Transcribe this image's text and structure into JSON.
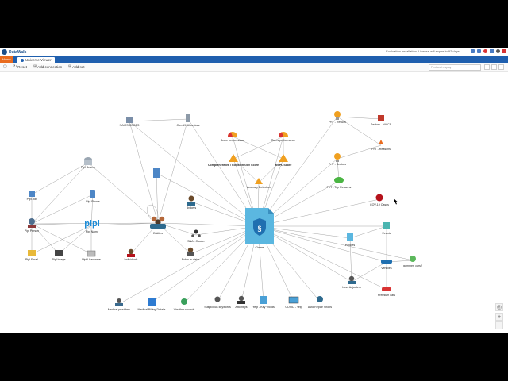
{
  "app": {
    "logo_text": "DataWalk",
    "license_text": "Evaluation installation. License will expire in 92 days."
  },
  "tabs": {
    "home": "Home",
    "active": "Universe Viewer"
  },
  "toolbar": {
    "reset": "Reset",
    "add_connection": "Add connection",
    "add_set": "Add set",
    "search_placeholder": "Find and display"
  },
  "nodes": {
    "claims": "Claims",
    "naics": "NAICS CODES",
    "covid_sectors": "Cov-19 All sectors",
    "pipl_search": "Pipl Search",
    "pipl_job": "Pipl Job",
    "pipl_phone": "Pipl Phone",
    "pipl_person": "Pipl Person",
    "pipl_name": "Pipl Name",
    "pipl_email": "Pipl Email",
    "pipl_image": "Pipl Image",
    "pipl_username": "Pipl Username",
    "entities": "Entities",
    "brokers": "Brokers",
    "sna_cluster": "SNA - Cluster",
    "roles_in_claim": "Roles in claim",
    "individuals": "Individuals",
    "score_performance": "Score performance",
    "rules_performance": "Rules performance",
    "comprehensive_score": "Comprehensive / Collision Gov Score",
    "mtpl_score": "MTPL Score",
    "anomaly_detection": "Anomaly Detection",
    "pnt_results": "PnT - Results",
    "sectors_naics": "Sectors - NAICS",
    "pnt_sectors": "PnT - Sectors",
    "pnt_reasons": "PnT - Reasons",
    "pnt_top_reasons": "PnT - Top Reasons",
    "covid_cases": "COV-19 Cases",
    "events": "Events",
    "policies": "Policies",
    "vehicles": "Vehicles",
    "gummer_cars": "gummer_cars2",
    "loss_adjusters": "Loss Adjusters",
    "premium_cars": "Premium cars",
    "medical_providers": "Medical providers",
    "medical_billing": "Medical Billing Details",
    "weather_records": "Weather records",
    "suspicious_keywords": "Suspicious keywords",
    "attorneys": "Attorneys",
    "yelp_key_words": "Yelp - Key Words",
    "covid_yelp": "COVID - Yelp",
    "auto_repair_shops": "Auto Repair Shops"
  },
  "icons": {
    "claims": "shield-document-icon",
    "people": "people-icon",
    "warning": "warning-icon",
    "gauge": "gauge-icon",
    "bulb": "lightbulb-icon",
    "virus": "virus-icon",
    "car": "car-icon",
    "recycle": "recycle-icon"
  },
  "colors": {
    "accent": "#1f5fae",
    "home_tab": "#e96b1e",
    "claims": "#5bb7e0",
    "warning": "#f0a020",
    "virus": "#b5121b"
  },
  "zoom_controls": {
    "fit": "◎",
    "plus": "+",
    "minus": "−"
  }
}
